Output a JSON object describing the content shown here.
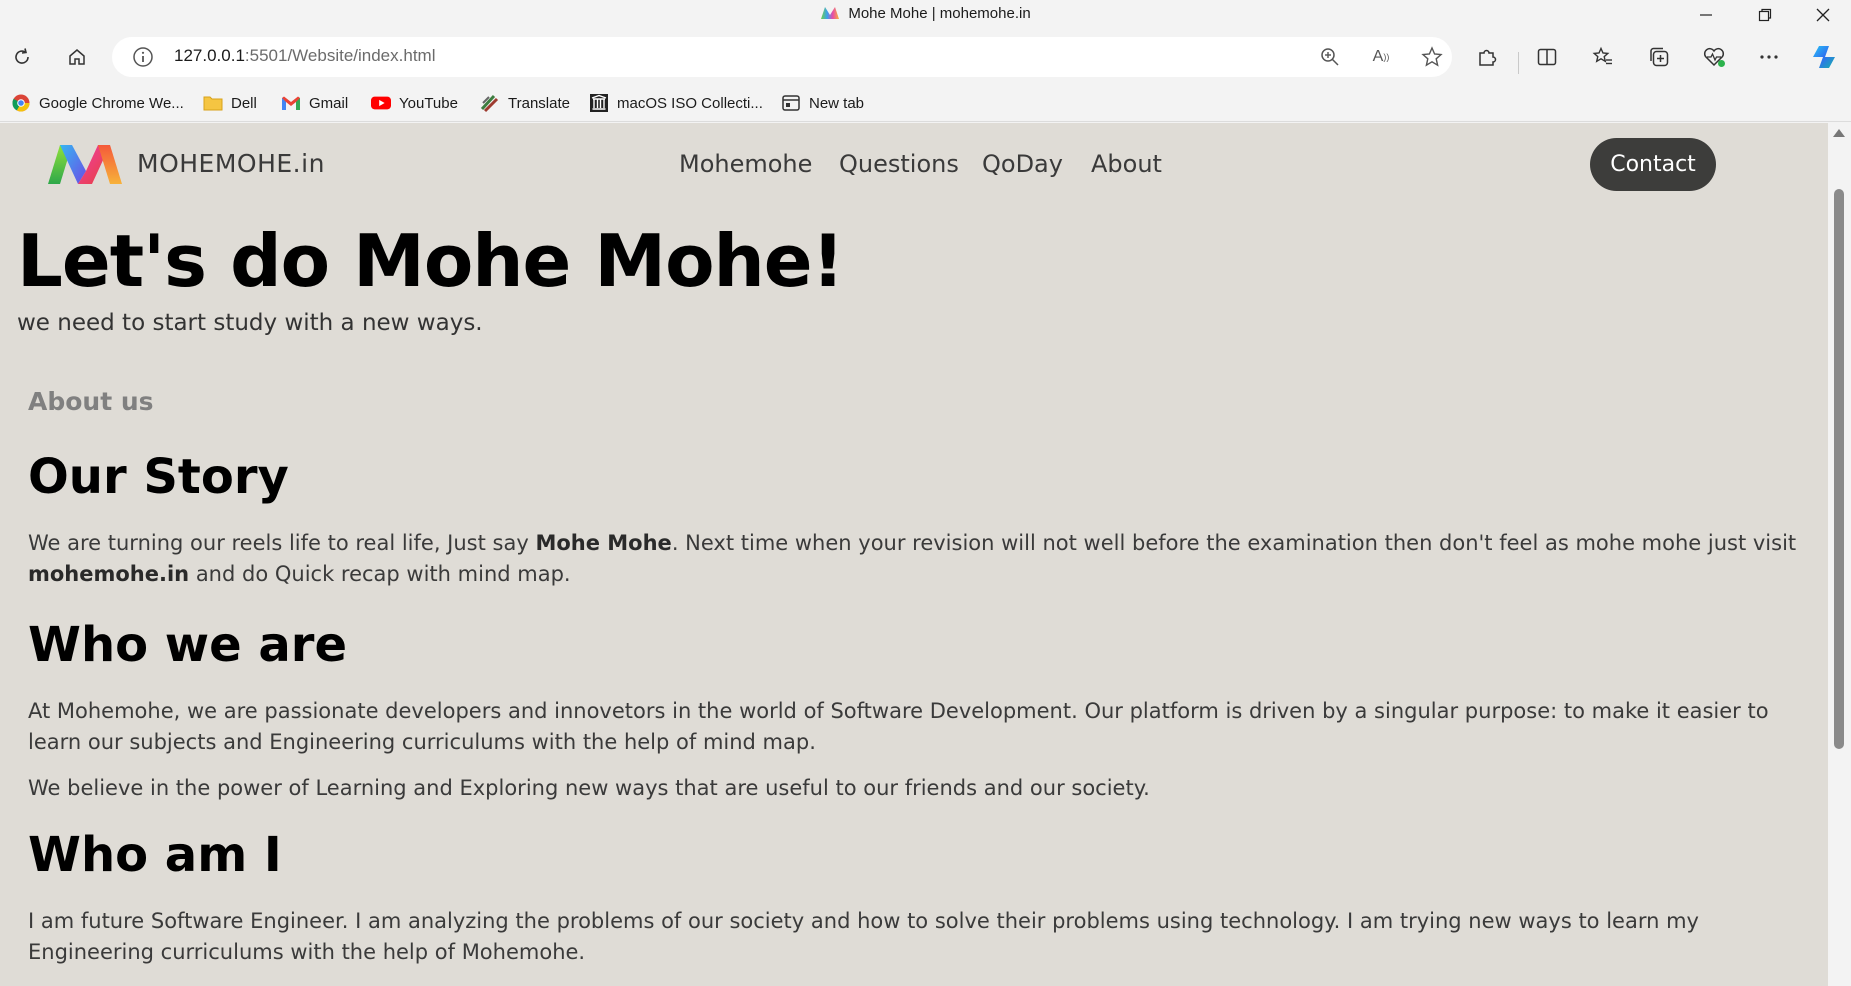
{
  "browser": {
    "tab_title": "Mohe Mohe | mohemohe.in",
    "url_host": "127.0.0.1",
    "url_rest": ":5501/Website/index.html",
    "bookmarks": [
      {
        "label": "Google Chrome We...",
        "icon": "chrome-icon"
      },
      {
        "label": "Dell",
        "icon": "folder-icon"
      },
      {
        "label": "Gmail",
        "icon": "gmail-icon"
      },
      {
        "label": "YouTube",
        "icon": "youtube-icon"
      },
      {
        "label": "Translate",
        "icon": "translate-icon"
      },
      {
        "label": "macOS ISO Collecti...",
        "icon": "archive-icon"
      },
      {
        "label": "New tab",
        "icon": "newtab-icon"
      }
    ]
  },
  "site": {
    "brand": "MOHEMOHE.in",
    "nav": [
      "Mohemohe",
      "Questions",
      "QoDay",
      "About"
    ],
    "contact_label": "Contact",
    "hero_title": "Let's do Mohe Mohe!",
    "hero_subtitle": "we need to start study with a new ways.",
    "about_label": "About us",
    "story": {
      "heading": "Our Story",
      "p1_a": "We are turning our reels life to real life, Just say ",
      "p1_bold": "Mohe Mohe",
      "p1_b": ". Next time when your revision will not well before the examination then don't feel as mohe mohe just visit ",
      "p1_bold2": "mohemohe.in",
      "p1_c": " and do Quick recap with mind map."
    },
    "who_we_are": {
      "heading": "Who we are",
      "p1": "At Mohemohe, we are passionate developers and innovetors in the world of Software Development. Our platform is driven by a singular purpose: to make it easier to learn our subjects and Engineering curriculums with the help of mind map.",
      "p2": "We believe in the power of Learning and Exploring new ways that are useful to our friends and our society."
    },
    "who_am_i": {
      "heading": "Who am I",
      "p1": "I am future Software Engineer. I am analyzing the problems of our society and how to solve their problems using technology. I am trying new ways to learn my Engineering curriculums with the help of Mohemohe."
    }
  },
  "colors": {
    "page_bg": "#dfdcd6",
    "contact_bg": "#3d3d3b",
    "about_label": "#808080"
  }
}
